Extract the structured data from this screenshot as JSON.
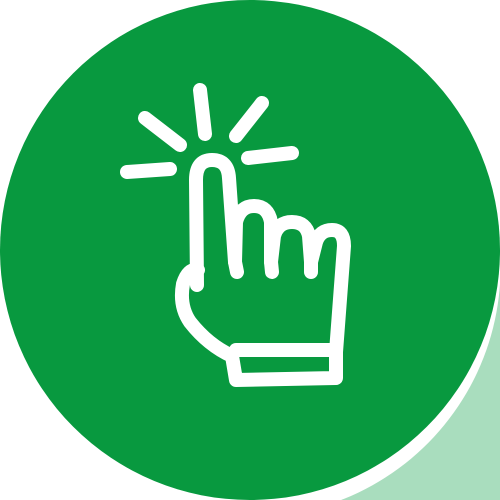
{
  "icon": {
    "name": "tap-hand-icon",
    "background_color": "#08993F",
    "highlight_color": "#0A9E44",
    "stroke_color": "#FFFFFF"
  }
}
